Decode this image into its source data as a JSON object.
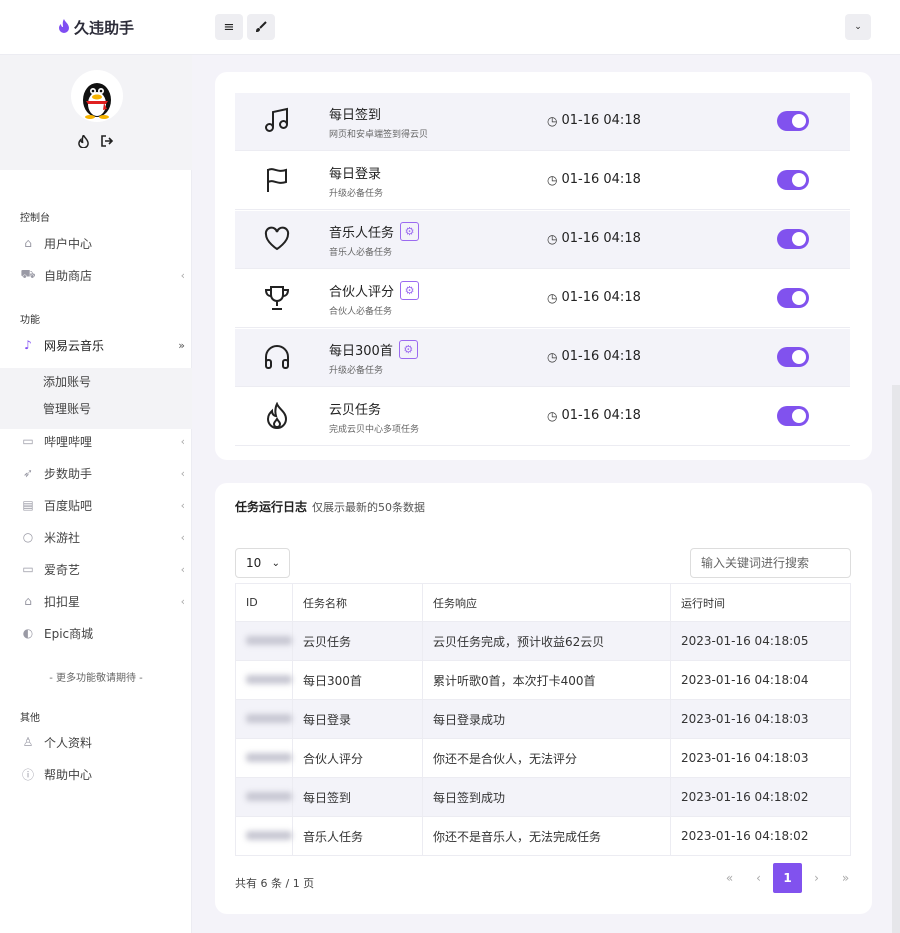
{
  "app": {
    "title": "久违助手"
  },
  "sidebar": {
    "sections": [
      "控制台",
      "功能",
      "其他"
    ],
    "items": [
      {
        "label": "用户中心",
        "icon": "home-icon"
      },
      {
        "label": "自助商店",
        "icon": "cart-icon"
      },
      {
        "label": "网易云音乐",
        "icon": "music-note-icon"
      },
      {
        "label": "哔哩哔哩",
        "icon": "video-icon"
      },
      {
        "label": "步数助手",
        "icon": "rocket-icon"
      },
      {
        "label": "百度贴吧",
        "icon": "book-icon"
      },
      {
        "label": "米游社",
        "icon": "bulb-icon"
      },
      {
        "label": "爱奇艺",
        "icon": "tv-icon"
      },
      {
        "label": "扣扣星",
        "icon": "graduation-cap-icon"
      },
      {
        "label": "Epic商城",
        "icon": "palette-icon"
      },
      {
        "label": "个人资料",
        "icon": "user-icon"
      },
      {
        "label": "帮助中心",
        "icon": "info-icon"
      }
    ],
    "sub_items": [
      "添加账号",
      "管理账号"
    ],
    "more": "- 更多功能敬请期待 -"
  },
  "tasks": [
    {
      "name": "每日签到",
      "desc": "网页和安卓端签到得云贝",
      "time": "01-16 04:18",
      "icon": "music-note-icon",
      "gear": false,
      "enabled": true
    },
    {
      "name": "每日登录",
      "desc": "升级必备任务",
      "time": "01-16 04:18",
      "icon": "flag-icon",
      "gear": false,
      "enabled": true
    },
    {
      "name": "音乐人任务",
      "desc": "音乐人必备任务",
      "time": "01-16 04:18",
      "icon": "heart-icon",
      "gear": true,
      "enabled": true
    },
    {
      "name": "合伙人评分",
      "desc": "合伙人必备任务",
      "time": "01-16 04:18",
      "icon": "trophy-icon",
      "gear": true,
      "enabled": true
    },
    {
      "name": "每日300首",
      "desc": "升级必备任务",
      "time": "01-16 04:18",
      "icon": "headphones-icon",
      "gear": true,
      "enabled": true
    },
    {
      "name": "云贝任务",
      "desc": "完成云贝中心多项任务",
      "time": "01-16 04:18",
      "icon": "fire-icon",
      "gear": false,
      "enabled": true
    }
  ],
  "log": {
    "title": "任务运行日志",
    "subtitle": "仅展示最新的50条数据",
    "page_size": "10",
    "search_placeholder": "输入关键词进行搜索",
    "columns": [
      "ID",
      "任务名称",
      "任务响应",
      "运行时间"
    ],
    "rows": [
      {
        "name": "云贝任务",
        "response": "云贝任务完成，预计收益62云贝",
        "time": "2023-01-16 04:18:05"
      },
      {
        "name": "每日300首",
        "response": "累计听歌0首，本次打卡400首",
        "time": "2023-01-16 04:18:04"
      },
      {
        "name": "每日登录",
        "response": "每日登录成功",
        "time": "2023-01-16 04:18:03"
      },
      {
        "name": "合伙人评分",
        "response": "你还不是合伙人，无法评分",
        "time": "2023-01-16 04:18:03"
      },
      {
        "name": "每日签到",
        "response": "每日签到成功",
        "time": "2023-01-16 04:18:02"
      },
      {
        "name": "音乐人任务",
        "response": "你还不是音乐人，无法完成任务",
        "time": "2023-01-16 04:18:02"
      }
    ],
    "summary": "共有 6 条 / 1 页",
    "pager": {
      "first": "«",
      "prev": "‹",
      "current": "1",
      "next": "›",
      "last": "»"
    }
  },
  "colors": {
    "accent": "#8152ee",
    "bg": "#f4f3f9"
  }
}
